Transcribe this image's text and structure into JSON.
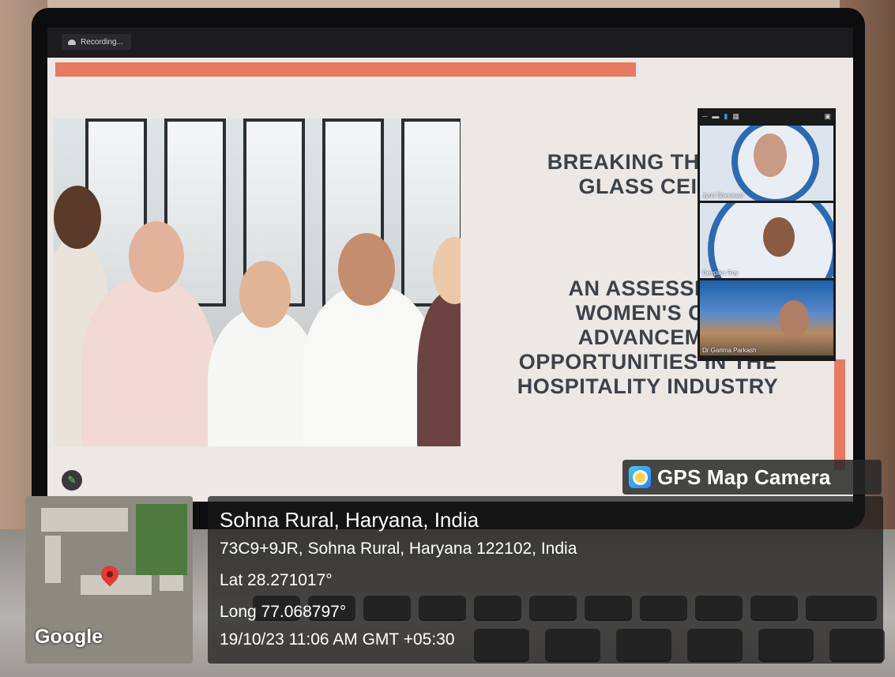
{
  "recording": {
    "label": "Recording..."
  },
  "slide": {
    "title_lines": [
      "BREAKING THROU",
      "GLASS CEILI"
    ],
    "subtitle_lines": [
      "AN  ASSESSME",
      "WOMEN'S CA",
      "ADVANCEME",
      "OPPORTUNITIES IN THE",
      "HOSPITALITY INDUSTRY"
    ]
  },
  "participants": [
    {
      "name": "Jyoti Sherawat"
    },
    {
      "name": "Deepika Roy"
    },
    {
      "name": "Dr Garima Parkash"
    }
  ],
  "gps": {
    "badge": "GPS Map Camera",
    "place": "Sohna Rural, Haryana, India",
    "address": "73C9+9JR, Sohna Rural, Haryana 122102, India",
    "lat": "Lat 28.271017°",
    "long": "Long 77.068797°",
    "datetime": "19/10/23 11:06 AM GMT +05:30",
    "map_brand": "Google"
  },
  "colors": {
    "accent": "#e87a61",
    "slide_text": "#3d4249",
    "logo_blue": "#2c6bb3"
  }
}
